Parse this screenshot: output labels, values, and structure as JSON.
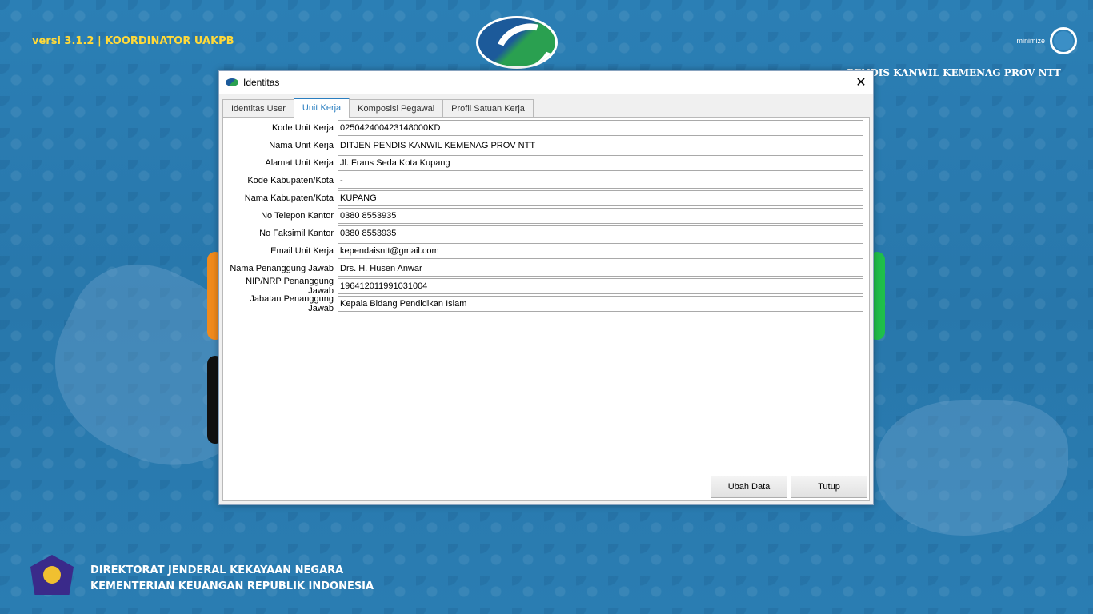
{
  "header": {
    "version": "versi 3.1.2 | KOORDINATOR UAKPB",
    "unit_title": "PENDIS KANWIL KEMENAG PROV NTT",
    "minimize_label": "minimize"
  },
  "footer": {
    "line1": "DIREKTORAT JENDERAL KEKAYAAN NEGARA",
    "line2": "KEMENTERIAN  KEUANGAN REPUBLIK INDONESIA"
  },
  "dialog": {
    "title": "Identitas",
    "close_glyph": "✕",
    "tabs": [
      {
        "label": "Identitas User"
      },
      {
        "label": "Unit Kerja"
      },
      {
        "label": "Komposisi Pegawai"
      },
      {
        "label": "Profil Satuan Kerja"
      }
    ],
    "active_tab": "Unit Kerja",
    "fields": [
      {
        "label": "Kode Unit Kerja",
        "value": "025042400423148000KD"
      },
      {
        "label": "Nama Unit Kerja",
        "value": "DITJEN PENDIS KANWIL KEMENAG PROV NTT"
      },
      {
        "label": "Alamat Unit Kerja",
        "value": "Jl. Frans Seda Kota Kupang"
      },
      {
        "label": "Kode Kabupaten/Kota",
        "value": "-"
      },
      {
        "label": "Nama Kabupaten/Kota",
        "value": "KUPANG"
      },
      {
        "label": "No Telepon Kantor",
        "value": "0380 8553935"
      },
      {
        "label": "No Faksimil Kantor",
        "value": "0380 8553935"
      },
      {
        "label": "Email Unit Kerja",
        "value": "kependaisntt@gmail.com"
      },
      {
        "label": "Nama Penanggung Jawab",
        "value": "Drs. H. Husen Anwar"
      },
      {
        "label": "NIP/NRP Penanggung Jawab",
        "value": "196412011991031004"
      },
      {
        "label": "Jabatan Penanggung Jawab",
        "value": "Kepala Bidang Pendidikan Islam"
      }
    ],
    "buttons": {
      "edit": "Ubah Data",
      "close": "Tutup"
    }
  },
  "colors": {
    "accent": "#2a7ec0",
    "version_text": "#ffd93a",
    "background": "#2a7bb0"
  }
}
